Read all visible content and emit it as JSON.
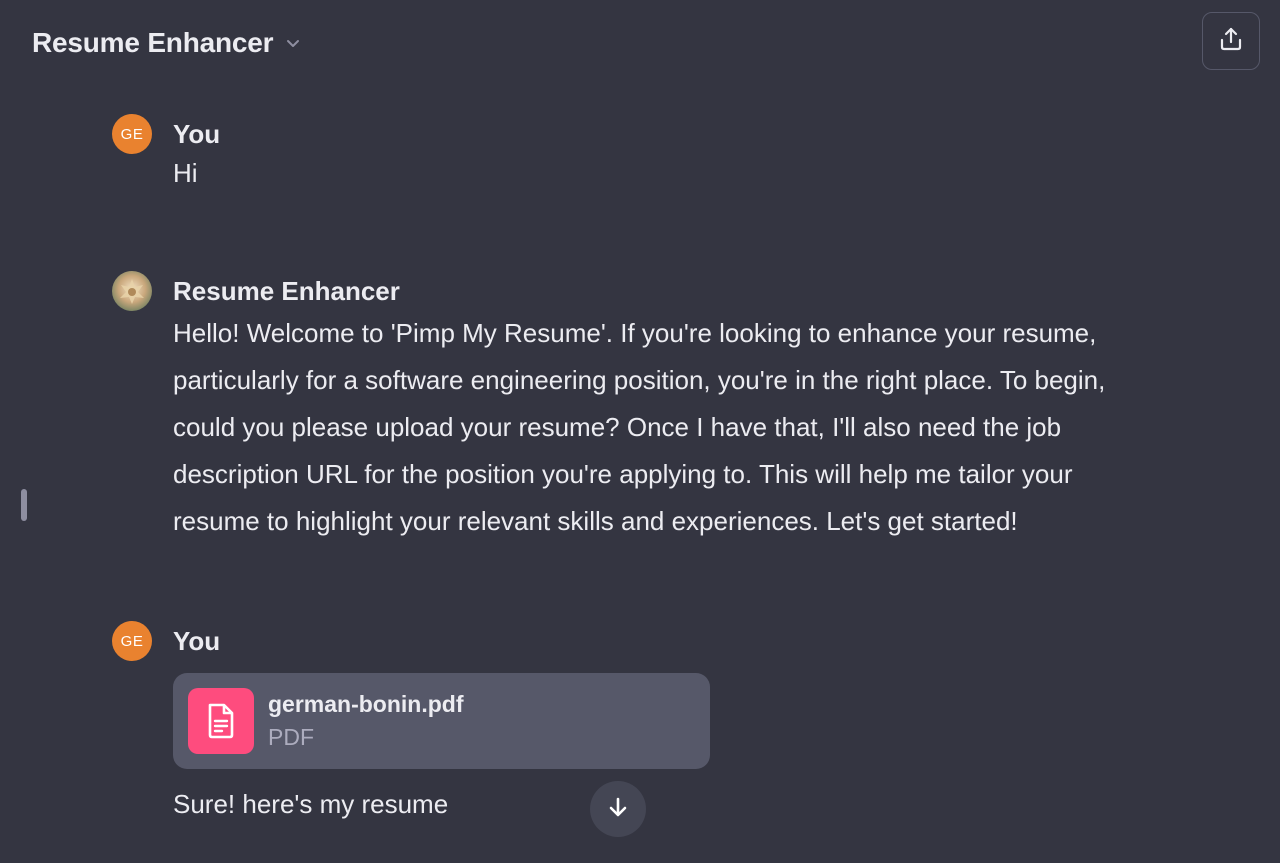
{
  "header": {
    "title": "Resume Enhancer",
    "chevron_icon": "chevron-down-icon",
    "share_icon": "share-upload-icon"
  },
  "messages": [
    {
      "author": "You",
      "avatar_initials": "GE",
      "text": "Hi"
    },
    {
      "author": "Resume Enhancer",
      "avatar_icon": "gpt-avatar-image",
      "lines": [
        "Hello! Welcome to 'Pimp My Resume'. If you're looking to enhance your resume,",
        "particularly for a software engineering position, you're in the right place. To begin,",
        "could you please upload your resume? Once I have that, I'll also need the job",
        "description URL for the position you're applying to. This will help me tailor your",
        "resume to highlight your relevant skills and experiences. Let's get started!"
      ]
    },
    {
      "author": "You",
      "avatar_initials": "GE",
      "attachment": {
        "name": "german-bonin.pdf",
        "type": "PDF",
        "icon": "document-icon"
      },
      "text": "Sure! here's my resume"
    }
  ],
  "scroll_down_icon": "arrow-down-icon",
  "colors": {
    "background": "#343541",
    "user_avatar": "#e9822f",
    "file_icon_bg": "#fe4c7e",
    "attachment_bg": "#565869"
  }
}
